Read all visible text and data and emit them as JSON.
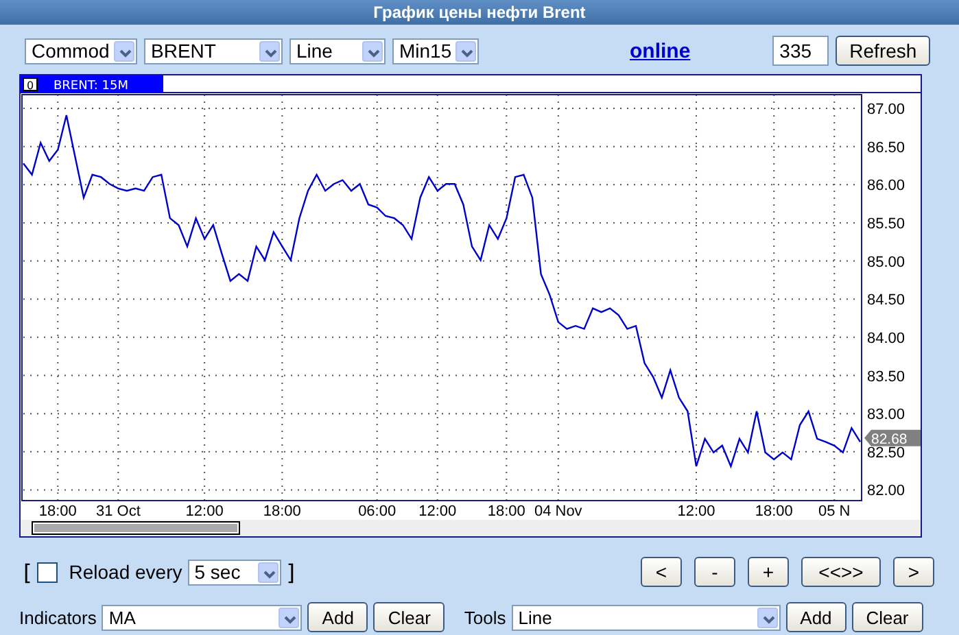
{
  "window": {
    "title": "График цены нефти Brent"
  },
  "toolbar": {
    "selects": [
      {
        "value": "Commod"
      },
      {
        "value": "BRENT"
      },
      {
        "value": "Line"
      },
      {
        "value": "Min15"
      }
    ],
    "link": "online",
    "count": "335",
    "refresh": "Refresh"
  },
  "chart": {
    "tab_badge": "0",
    "tab_label": "BRENT: 15M",
    "price_tag": "82.68",
    "chart_data": {
      "type": "line",
      "ylim": [
        81.86,
        87.18
      ],
      "grid": true,
      "categories": [
        null,
        null,
        null,
        null,
        "18:00",
        null,
        null,
        null,
        null,
        null,
        null,
        "31 Oct",
        null,
        null,
        null,
        null,
        null,
        null,
        null,
        null,
        null,
        "12:00",
        null,
        null,
        null,
        null,
        null,
        null,
        null,
        null,
        "18:00",
        null,
        null,
        null,
        null,
        null,
        null,
        null,
        null,
        null,
        null,
        "06:00",
        null,
        null,
        null,
        null,
        null,
        null,
        "12:00",
        null,
        null,
        null,
        null,
        null,
        null,
        null,
        "18:00",
        null,
        null,
        null,
        null,
        null,
        "04 Nov",
        null,
        null,
        null,
        null,
        null,
        null,
        null,
        null,
        null,
        null,
        null,
        null,
        null,
        null,
        null,
        "12:00",
        null,
        null,
        null,
        null,
        null,
        null,
        null,
        null,
        "18:00",
        null,
        null,
        null,
        null,
        null,
        null,
        "05 N",
        null,
        null,
        null
      ],
      "yticks": [
        {
          "value": 82,
          "label": "82.00"
        },
        {
          "value": 82.5,
          "label": "82.50"
        },
        {
          "value": 83,
          "label": "83.00"
        },
        {
          "value": 83.5,
          "label": "83.50"
        },
        {
          "value": 84,
          "label": "84.00"
        },
        {
          "value": 84.5,
          "label": "84.50"
        },
        {
          "value": 85,
          "label": "85.00"
        },
        {
          "value": 85.5,
          "label": "85.50"
        },
        {
          "value": 86,
          "label": "86.00"
        },
        {
          "value": 86.5,
          "label": "86.50"
        },
        {
          "value": 87,
          "label": "87.00"
        }
      ],
      "series": [
        {
          "color": "#0000cc",
          "values": [
            86.28,
            86.13,
            86.55,
            86.31,
            86.46,
            86.91,
            86.37,
            85.83,
            86.13,
            86.1,
            86.01,
            85.95,
            85.92,
            85.95,
            85.92,
            86.1,
            86.13,
            85.56,
            85.47,
            85.19,
            85.56,
            85.29,
            85.47,
            85.1,
            84.74,
            84.83,
            84.74,
            85.19,
            85.01,
            85.38,
            85.19,
            85.01,
            85.56,
            85.92,
            86.13,
            85.92,
            86.01,
            86.06,
            85.92,
            86.01,
            85.74,
            85.7,
            85.59,
            85.56,
            85.47,
            85.29,
            85.83,
            86.1,
            85.92,
            86.01,
            86.01,
            85.74,
            85.19,
            85.01,
            85.47,
            85.29,
            85.56,
            86.1,
            86.13,
            85.83,
            84.83,
            84.56,
            84.2,
            84.11,
            84.15,
            84.11,
            84.38,
            84.33,
            84.38,
            84.29,
            84.11,
            84.15,
            83.66,
            83.48,
            83.21,
            83.57,
            83.21,
            83.03,
            82.31,
            82.67,
            82.49,
            82.58,
            82.31,
            82.67,
            82.49,
            83.03,
            82.49,
            82.4,
            82.49,
            82.4,
            82.85,
            83.03,
            82.67,
            82.63,
            82.58,
            82.49,
            82.81,
            82.63
          ]
        }
      ]
    }
  },
  "reload": {
    "open": "[",
    "checked": false,
    "label": "Reload every",
    "interval": "5 sec",
    "close": "]"
  },
  "nav_buttons": [
    "<",
    "-",
    "+",
    "<<>>",
    ">"
  ],
  "indicators": {
    "label": "Indicators",
    "value": "MA",
    "add": "Add",
    "clear": "Clear"
  },
  "tools": {
    "label": "Tools",
    "value": "Line",
    "add": "Add",
    "clear": "Clear"
  }
}
